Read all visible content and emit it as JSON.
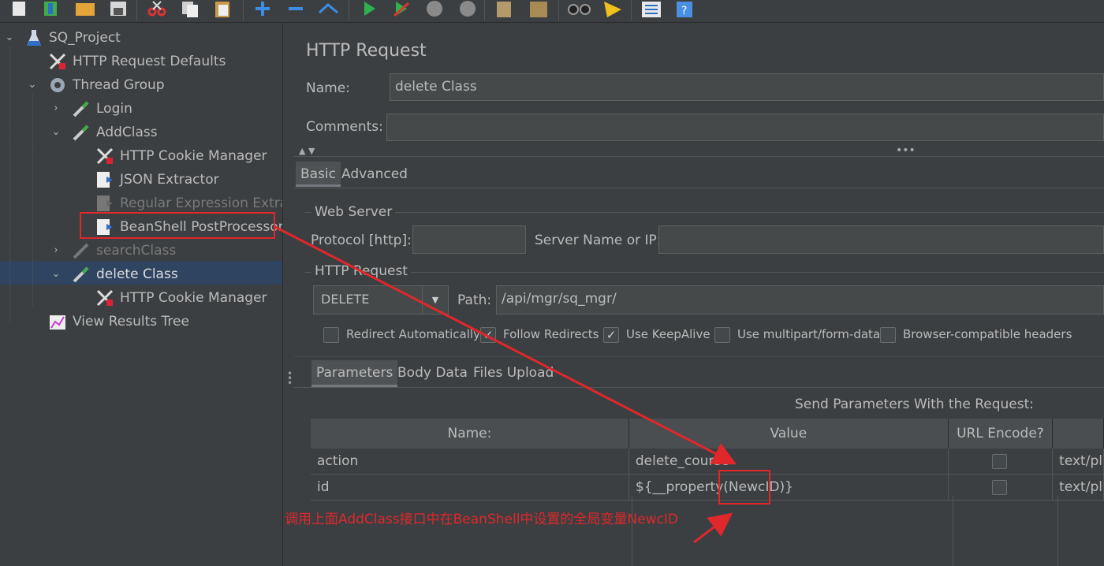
{
  "toolbar": {
    "icons": [
      "new-icon",
      "templates-icon",
      "open-icon",
      "save-icon",
      "cut-icon",
      "copy-icon",
      "paste-icon",
      "expand-icon",
      "collapse-icon",
      "toggle-icon",
      "start-icon",
      "start-no-pause-icon",
      "stop-icon",
      "shutdown-icon",
      "clear-icon",
      "clear-all-icon",
      "search-icon",
      "reset-search-icon",
      "function-helper-icon",
      "help-icon"
    ]
  },
  "tree": {
    "root": "SQ_Project",
    "http_defaults": "HTTP Request Defaults",
    "thread_group": "Thread Group",
    "login": "Login",
    "addclass": "AddClass",
    "addclass_cookie": "HTTP Cookie Manager",
    "json_extractor": "JSON Extractor",
    "regex_extractor": "Regular Expression Extract",
    "beanshell": "BeanShell PostProcessor",
    "searchclass": "searchClass",
    "delete_class": "delete Class",
    "delete_cookie": "HTTP Cookie Manager",
    "view_results": "View Results Tree"
  },
  "panel": {
    "title": "HTTP Request",
    "name_label": "Name:",
    "name_value": "delete Class",
    "comments_label": "Comments:",
    "comments_value": "",
    "tabs": [
      "Basic",
      "Advanced"
    ],
    "web_server": {
      "legend": "Web Server",
      "protocol_label": "Protocol [http]:",
      "protocol_value": "",
      "server_label": "Server Name or IP:",
      "server_value": ""
    },
    "http_request": {
      "legend": "HTTP Request",
      "method": "DELETE",
      "path_label": "Path:",
      "path_value": "/api/mgr/sq_mgr/"
    },
    "checkboxes": [
      {
        "label": "Redirect Automatically",
        "checked": false
      },
      {
        "label": "Follow Redirects",
        "checked": true
      },
      {
        "label": "Use KeepAlive",
        "checked": true
      },
      {
        "label": "Use multipart/form-data",
        "checked": false
      },
      {
        "label": "Browser-compatible headers",
        "checked": false
      }
    ],
    "sub_tabs": [
      "Parameters",
      "Body Data",
      "Files Upload"
    ],
    "params_title": "Send Parameters With the Request:",
    "columns": [
      "Name:",
      "Value",
      "URL Encode?",
      ""
    ],
    "rows": [
      {
        "name": "action",
        "value": "delete_course",
        "encode": false,
        "content_type": "text/pl"
      },
      {
        "name": "id",
        "value": "${__property(NewcID)}",
        "encode": false,
        "content_type": "text/pl"
      }
    ]
  },
  "annotation": {
    "text": "调用上面AddClass接口中在BeanShell中设置的全局变量NewcID",
    "color": "#e0272b"
  }
}
